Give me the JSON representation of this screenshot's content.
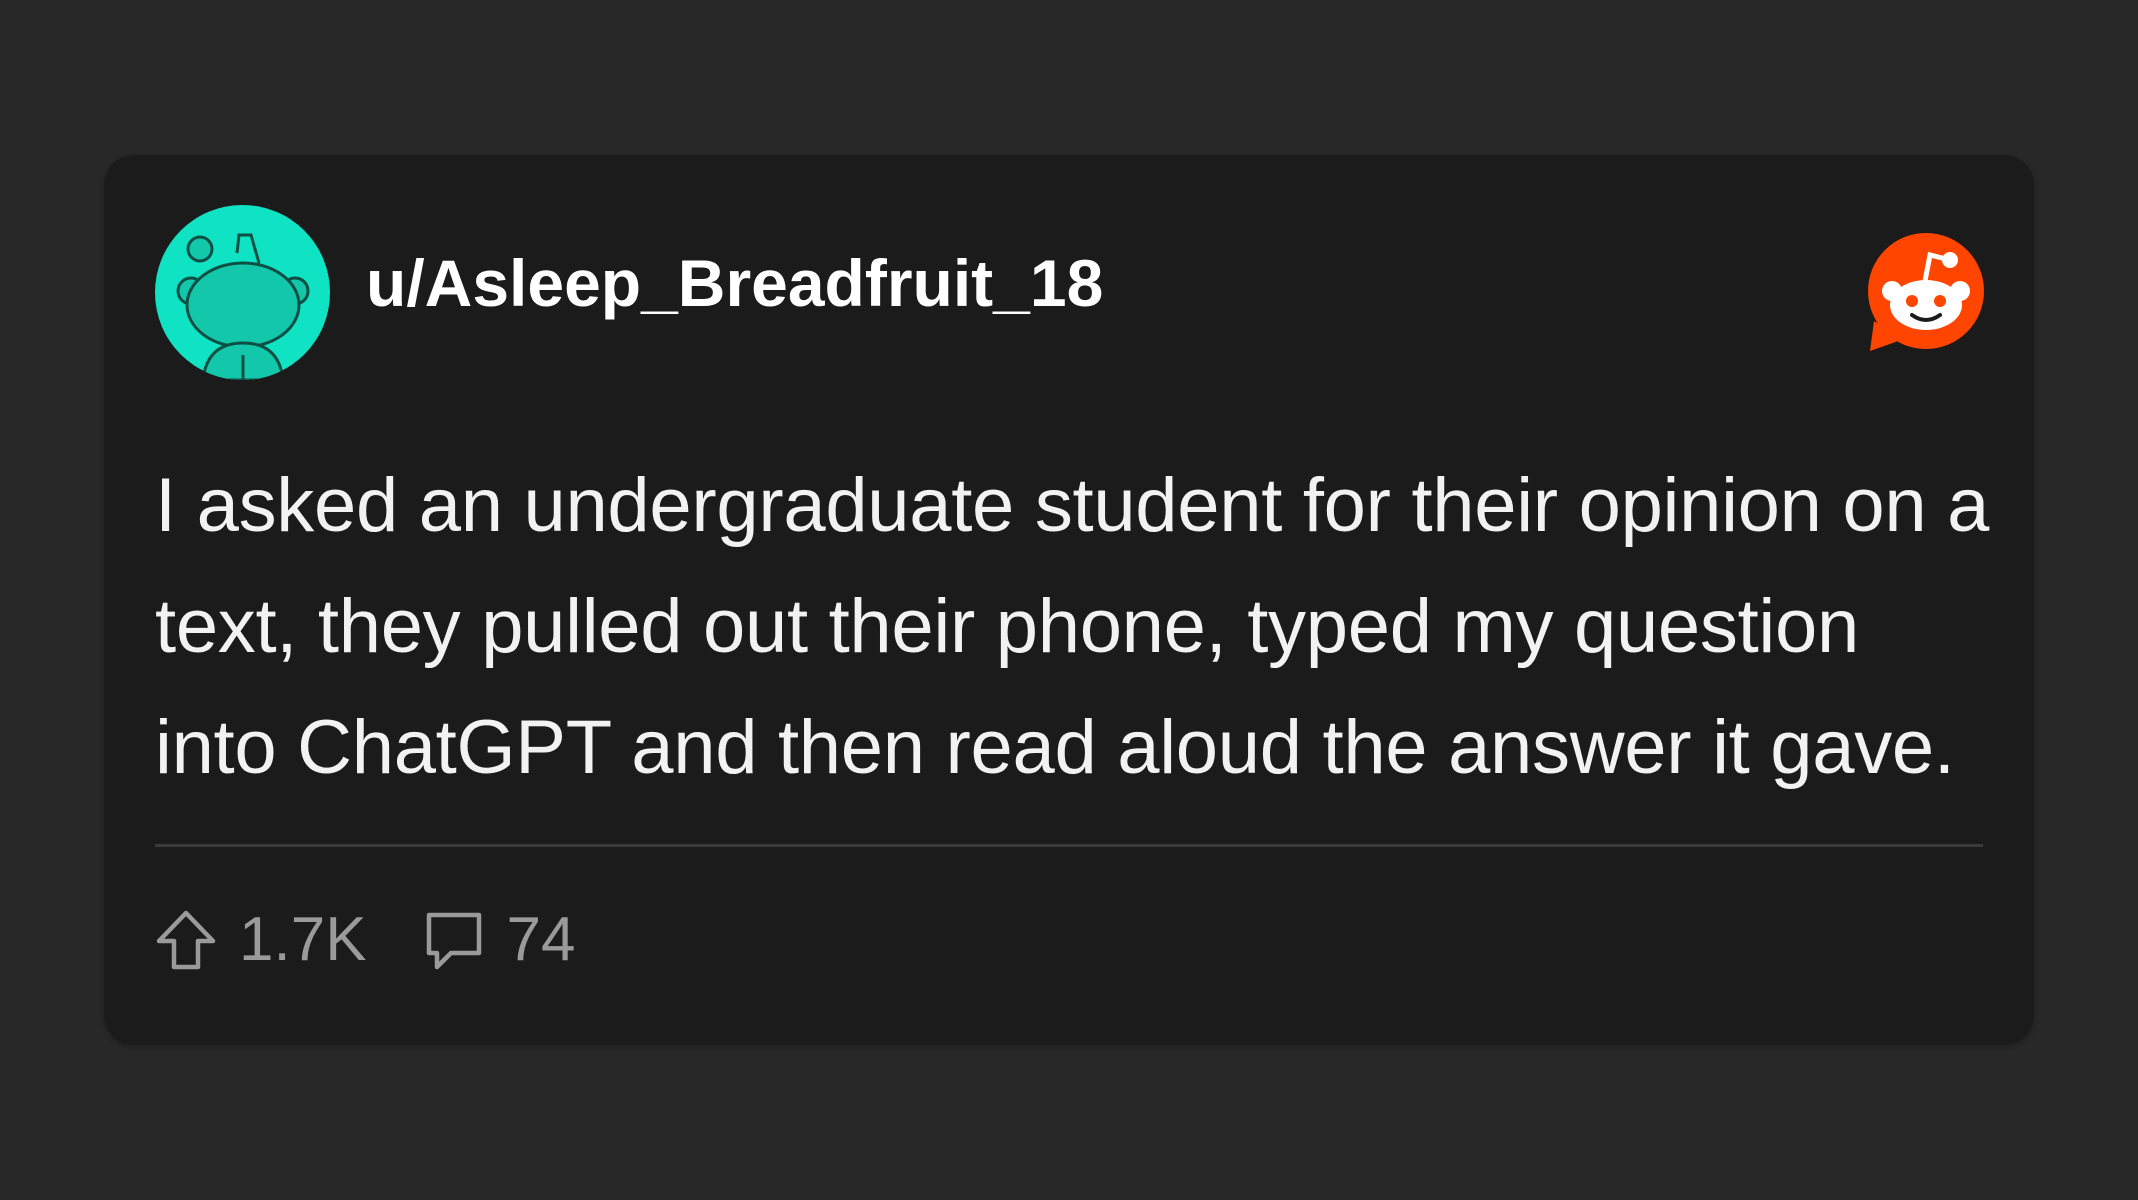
{
  "post": {
    "username": "u/Asleep_Breadfruit_18",
    "text": "I asked an undergraduate student for their opinion on a text, they pulled out their phone, typed my question into ChatGPT and then read aloud the answer it gave.",
    "upvotes": "1.7K",
    "comments": "74"
  },
  "icons": {
    "avatar": "snoo-avatar",
    "brand": "reddit-logo-icon",
    "upvote": "upvote-arrow-icon",
    "comment": "comment-bubble-icon"
  },
  "colors": {
    "page_background": "#282828",
    "card_background": "#1b1b1b",
    "avatar_background": "#0fe3c2",
    "reddit_orange": "#ff4500",
    "text_primary": "#ffffff",
    "text_secondary": "#9a9a9a"
  }
}
